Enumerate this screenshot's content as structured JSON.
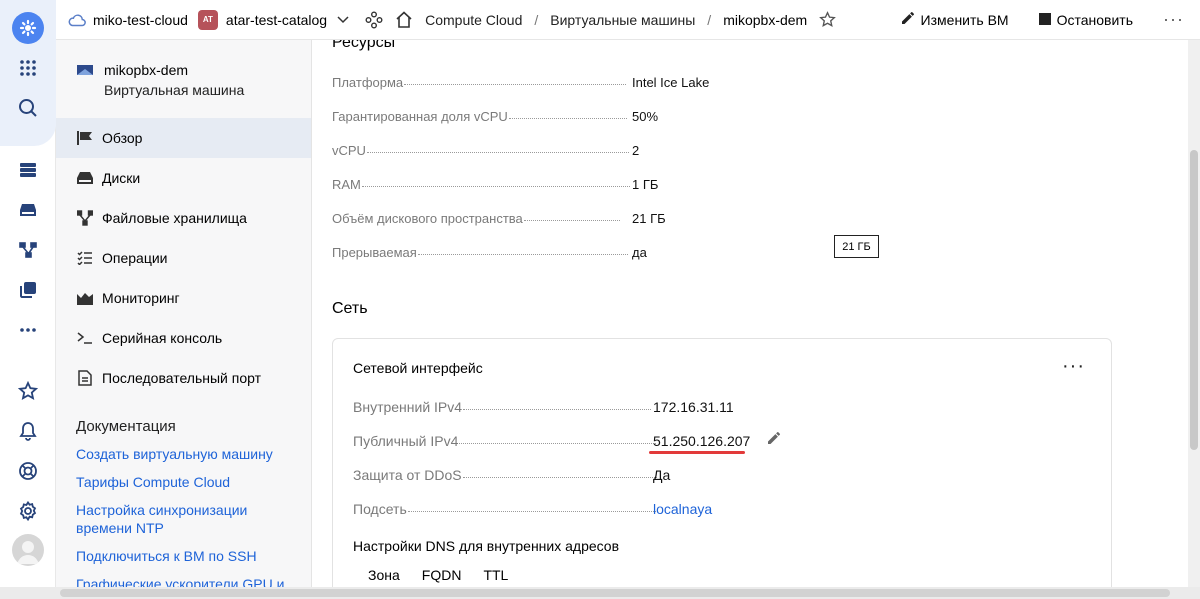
{
  "header": {
    "cloud_name": "miko-test-cloud",
    "catalog_badge": "AT",
    "catalog_name": "atar-test-catalog",
    "breadcrumbs": [
      "Compute Cloud",
      "Виртуальные машины",
      "mikopbx-dem"
    ],
    "separator": "/",
    "edit_label": "Изменить ВМ",
    "stop_label": "Остановить",
    "more_label": "···"
  },
  "sidebar": {
    "vm_name": "mikopbx-dem",
    "vm_type": "Виртуальная машина",
    "nav": [
      {
        "label": "Обзор",
        "icon": "overview-icon",
        "active": true
      },
      {
        "label": "Диски",
        "icon": "disk-icon"
      },
      {
        "label": "Файловые хранилища",
        "icon": "filestore-icon"
      },
      {
        "label": "Операции",
        "icon": "operations-icon"
      },
      {
        "label": "Мониторинг",
        "icon": "monitoring-icon"
      },
      {
        "label": "Серийная консоль",
        "icon": "terminal-icon"
      },
      {
        "label": "Последовательный порт",
        "icon": "port-icon"
      }
    ],
    "docs_title": "Документация",
    "docs_links": [
      "Создать виртуальную машину",
      "Тарифы Compute Cloud",
      "Настройка синхронизации времени NTP",
      "Подключиться к ВМ по SSH",
      "Графические ускорители GPU и"
    ]
  },
  "resources": {
    "title": "Ресурсы",
    "rows": [
      {
        "key": "Платформа",
        "value": "Intel Ice Lake"
      },
      {
        "key": "Гарантированная доля vCPU",
        "value": "50%"
      },
      {
        "key": "vCPU",
        "value": "2"
      },
      {
        "key": "RAM",
        "value": "1 ГБ"
      },
      {
        "key": "Объём дискового пространства",
        "value": "21 ГБ"
      },
      {
        "key": "Прерываемая",
        "value": "да"
      }
    ],
    "tooltip": "21 ГБ"
  },
  "network": {
    "title": "Сеть",
    "card_title": "Сетевой интерфейс",
    "card_more": "···",
    "rows": [
      {
        "key": "Внутренний IPv4",
        "value": "172.16.31.11"
      },
      {
        "key": "Публичный IPv4",
        "value": "51.250.126.207"
      },
      {
        "key": "Защита от DDoS",
        "value": "Да"
      },
      {
        "key": "Подсеть",
        "value": "localnaya"
      }
    ],
    "dns_title": "Настройки DNS для внутренних адресов",
    "dns_columns": [
      "Зона",
      "FQDN",
      "TTL"
    ]
  }
}
